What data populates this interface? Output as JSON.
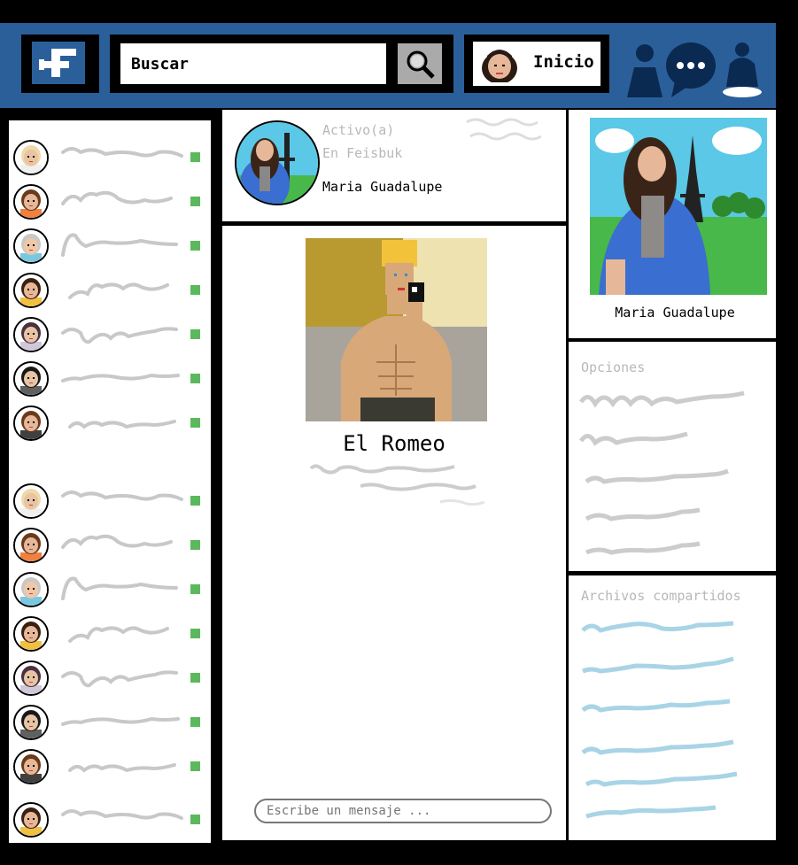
{
  "header": {
    "search_label": "Buscar",
    "home_label": "Inicio",
    "icons": [
      "logo-icon",
      "search-icon",
      "friends-icon",
      "messages-icon",
      "notifications-icon"
    ]
  },
  "contacts": [
    {
      "avatar": "avatar-blonde-boy",
      "status": "online"
    },
    {
      "avatar": "avatar-girl-pigtails",
      "status": "online"
    },
    {
      "avatar": "avatar-grandma",
      "status": "online"
    },
    {
      "avatar": "avatar-girl-curly",
      "status": "online"
    },
    {
      "avatar": "avatar-girl-hijab",
      "status": "online"
    },
    {
      "avatar": "avatar-girl-dark-hair",
      "status": "online"
    },
    {
      "avatar": "avatar-boy-brown",
      "status": "online"
    },
    {
      "avatar": "avatar-blonde-boy",
      "status": "online"
    },
    {
      "avatar": "avatar-girl-pigtails",
      "status": "online"
    },
    {
      "avatar": "avatar-grandma",
      "status": "online"
    },
    {
      "avatar": "avatar-girl-curly",
      "status": "online"
    },
    {
      "avatar": "avatar-girl-hijab",
      "status": "online"
    },
    {
      "avatar": "avatar-girl-dark-hair",
      "status": "online"
    },
    {
      "avatar": "avatar-boy-brown",
      "status": "online"
    },
    {
      "avatar": "avatar-girl-curly",
      "status": "online"
    }
  ],
  "chat": {
    "status_line1": "Activo(a)",
    "status_line2": "En Feisbuk",
    "contact_name": "Maria Guadalupe",
    "shared_photo_caption": "El Romeo",
    "message_placeholder": "Escribe un mensaje ..."
  },
  "profile": {
    "name": "Maria Guadalupe"
  },
  "options": {
    "title": "Opciones"
  },
  "files": {
    "title": "Archivos compartidos"
  },
  "colors": {
    "brand_blue": "#2b5f9a",
    "online_green": "#5cb85c",
    "file_link_blue": "#a8d4e6",
    "scribble_gray": "#c8c8c8"
  }
}
